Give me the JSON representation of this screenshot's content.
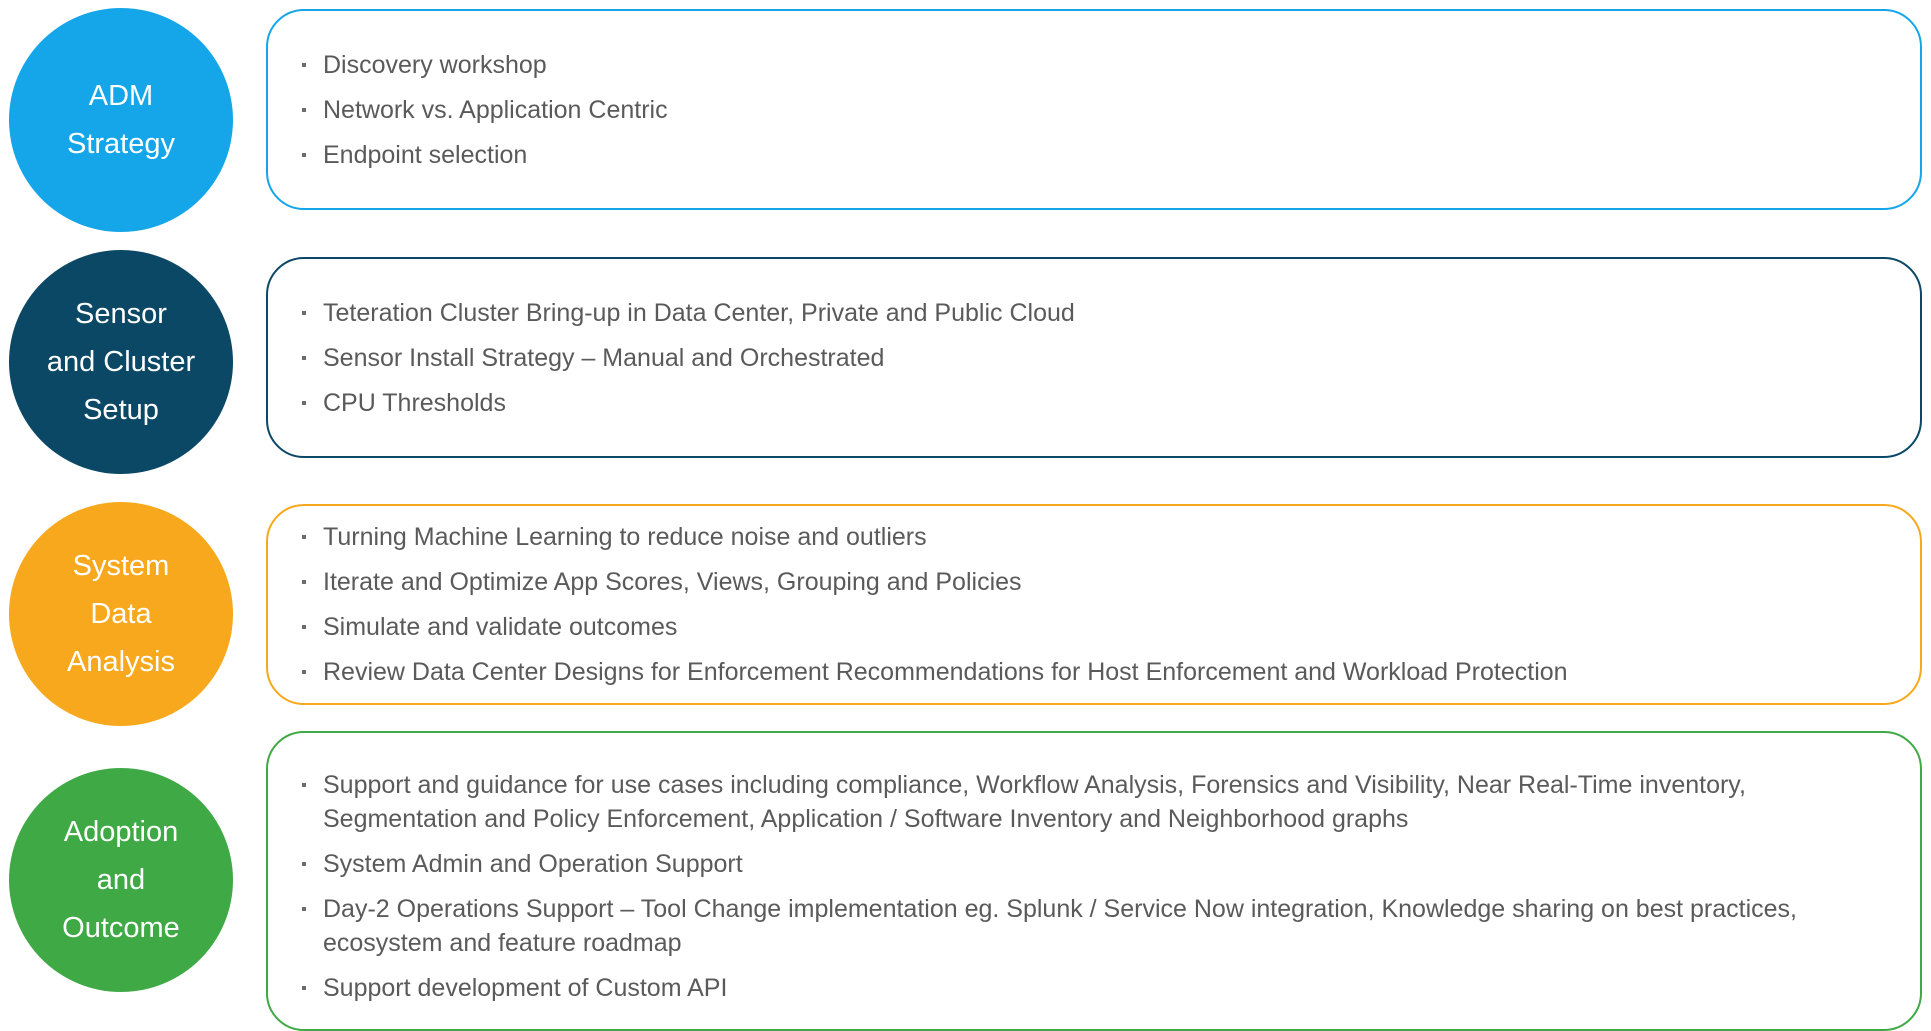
{
  "colors": {
    "adm": "#14a6e8",
    "sensor": "#0b4866",
    "system": "#f7a81c",
    "adoption": "#3fa945",
    "text": "#5a5a5a"
  },
  "stages": [
    {
      "circle_lines": [
        "ADM",
        "Strategy"
      ],
      "bullets": [
        "Discovery workshop",
        "Network vs. Application Centric",
        "Endpoint selection"
      ]
    },
    {
      "circle_lines": [
        "Sensor",
        "and Cluster",
        "Setup"
      ],
      "bullets": [
        "Teteration Cluster Bring-up in Data Center, Private and Public Cloud",
        "Sensor Install Strategy – Manual and Orchestrated",
        "CPU Thresholds"
      ]
    },
    {
      "circle_lines": [
        "System",
        "Data",
        "Analysis"
      ],
      "bullets": [
        "Turning Machine Learning to reduce noise and outliers",
        "Iterate and Optimize App Scores, Views, Grouping and Policies",
        "Simulate and validate outcomes",
        "Review Data Center Designs for Enforcement Recommendations for Host Enforcement and Workload Protection"
      ]
    },
    {
      "circle_lines": [
        "Adoption",
        "and",
        "Outcome"
      ],
      "bullets": [
        "Support and guidance for use cases including compliance, Workflow Analysis, Forensics and Visibility, Near Real-Time inventory, Segmentation and Policy Enforcement, Application / Software Inventory and Neighborhood graphs",
        "System Admin and Operation Support",
        "Day-2 Operations Support – Tool Change implementation eg. Splunk / Service Now integration, Knowledge sharing on best practices, ecosystem and feature roadmap",
        "Support development of Custom API"
      ]
    }
  ]
}
